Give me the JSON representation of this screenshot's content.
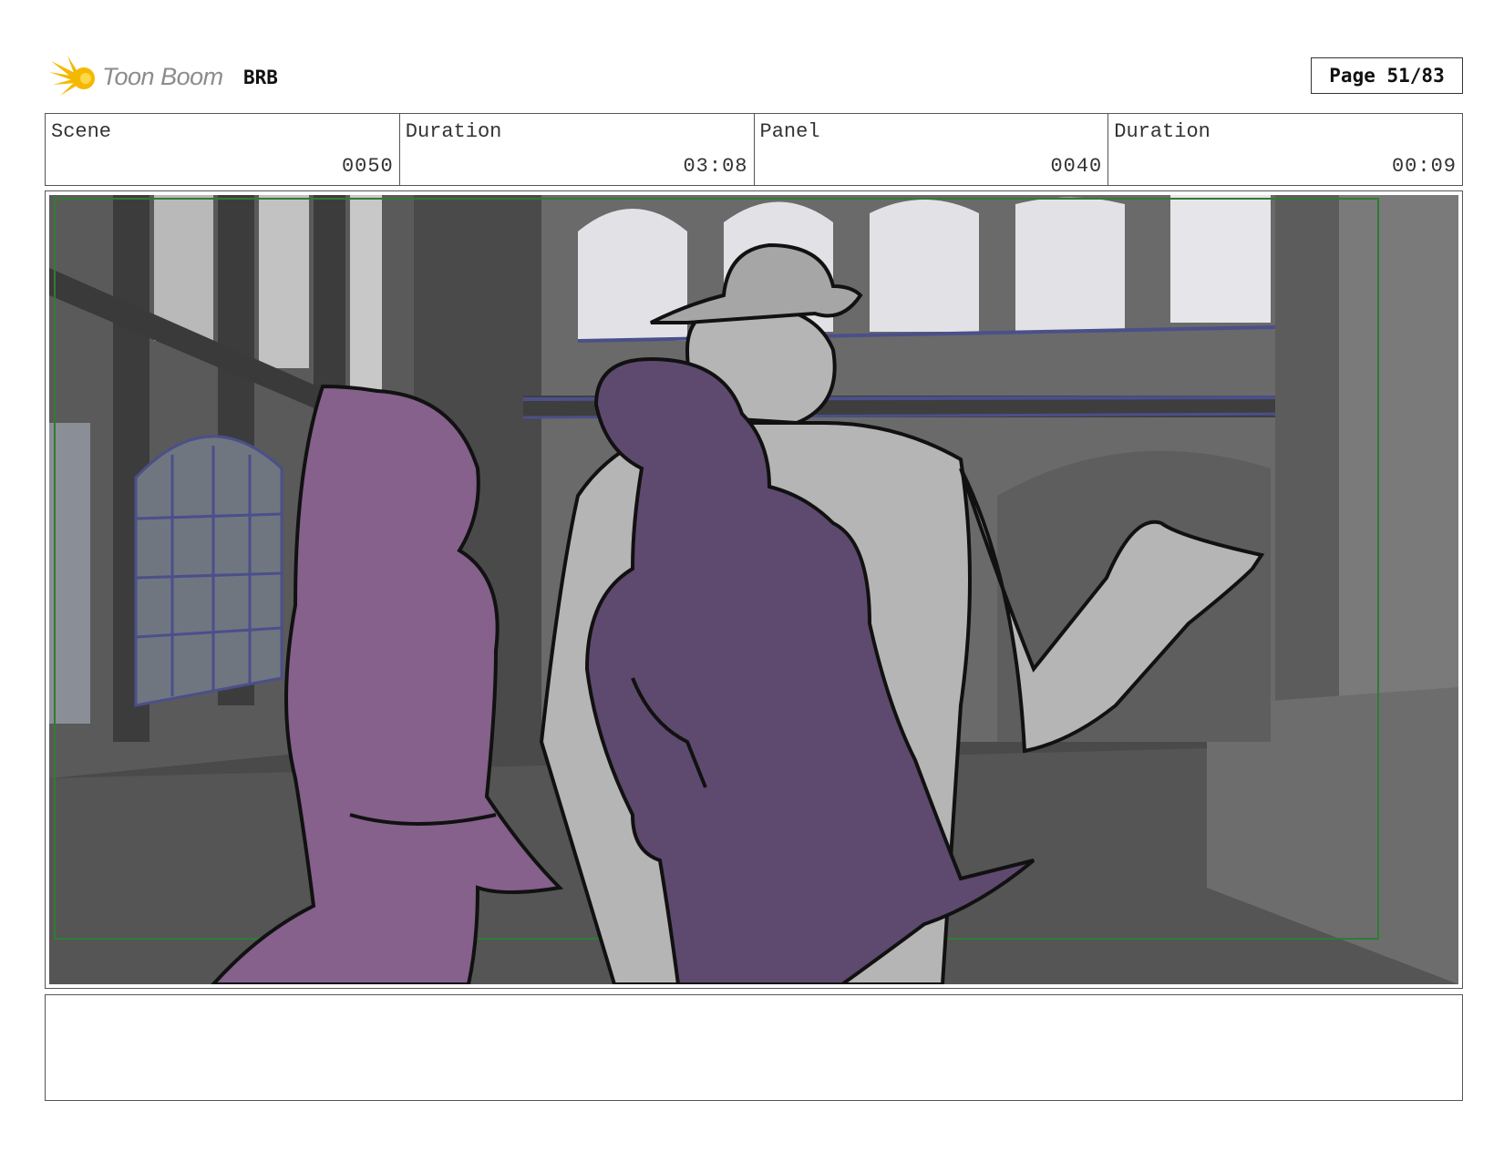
{
  "header": {
    "logo_text": "Toon Boom",
    "project_name": "BRB",
    "page_label": "Page 51/83"
  },
  "info": {
    "scene_label": "Scene",
    "scene_value": "0050",
    "scene_duration_label": "Duration",
    "scene_duration_value": "03:08",
    "panel_label": "Panel",
    "panel_value": "0040",
    "panel_duration_label": "Duration",
    "panel_duration_value": "00:09"
  },
  "colors": {
    "logo_star": "#f5b800",
    "frame_guide": "#2e7d32",
    "character_left": "#85618c",
    "character_center": "#5e4a6e",
    "character_grey": "#b5b5b5",
    "background_dark": "#4a4a4a",
    "window_light": "#e2e2e6"
  },
  "panel_art": {
    "icon": "storyboard-sketch",
    "subject": "three characters in a grand hall"
  },
  "notes": {
    "text": ""
  }
}
